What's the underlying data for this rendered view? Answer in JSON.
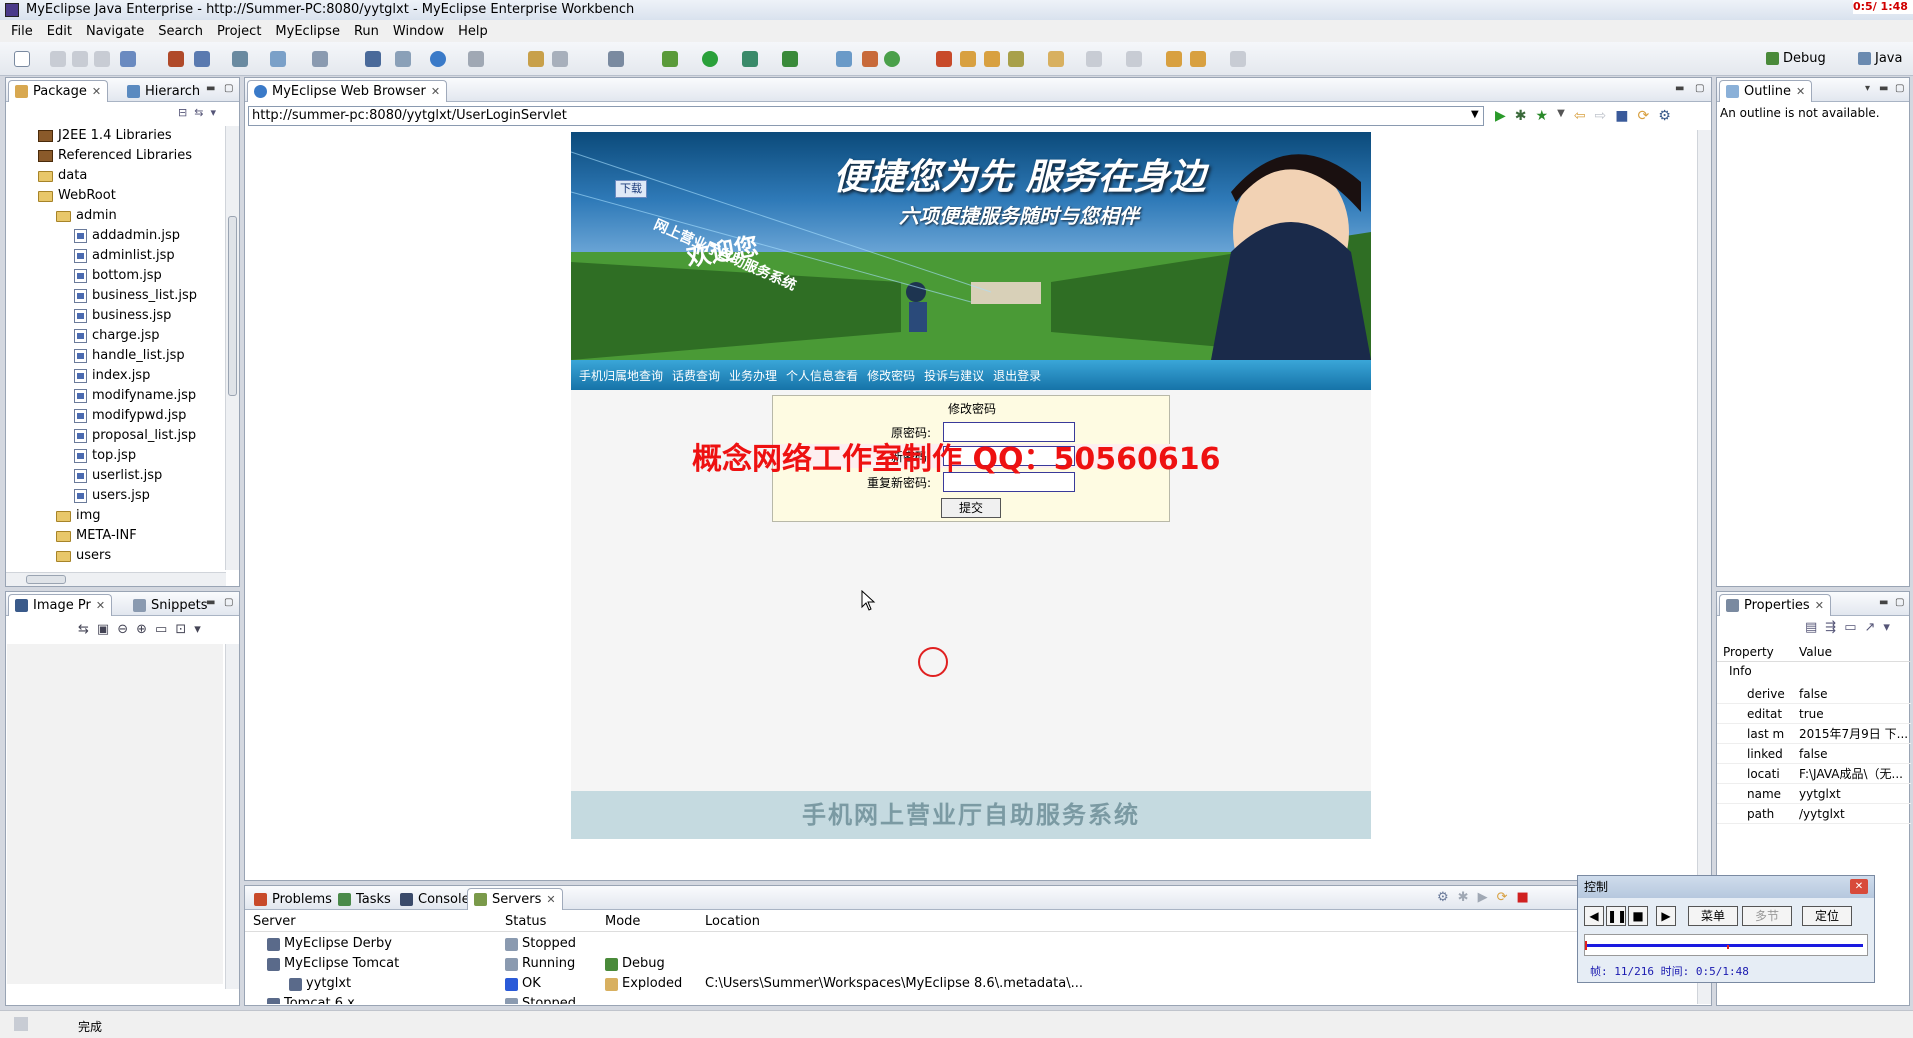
{
  "window": {
    "title": "MyEclipse Java Enterprise - http://Summer-PC:8080/yytglxt - MyEclipse Enterprise Workbench",
    "recorder_time": "0:5/ 1:48"
  },
  "menu": [
    "File",
    "Edit",
    "Navigate",
    "Search",
    "Project",
    "MyEclipse",
    "Run",
    "Window",
    "Help"
  ],
  "perspectives": {
    "debug": "Debug",
    "java": "Java"
  },
  "package_explorer": {
    "tabs": [
      "Package",
      "Hierarch"
    ],
    "items": [
      {
        "label": "J2EE 1.4 Libraries",
        "indent": 1,
        "kind": "lib"
      },
      {
        "label": "Referenced Libraries",
        "indent": 1,
        "kind": "lib"
      },
      {
        "label": "data",
        "indent": 1,
        "kind": "folder"
      },
      {
        "label": "WebRoot",
        "indent": 1,
        "kind": "folder"
      },
      {
        "label": "admin",
        "indent": 2,
        "kind": "folder"
      },
      {
        "label": "addadmin.jsp",
        "indent": 3,
        "kind": "jsp"
      },
      {
        "label": "adminlist.jsp",
        "indent": 3,
        "kind": "jsp"
      },
      {
        "label": "bottom.jsp",
        "indent": 3,
        "kind": "jsp"
      },
      {
        "label": "business_list.jsp",
        "indent": 3,
        "kind": "jsp"
      },
      {
        "label": "business.jsp",
        "indent": 3,
        "kind": "jsp"
      },
      {
        "label": "charge.jsp",
        "indent": 3,
        "kind": "jsp"
      },
      {
        "label": "handle_list.jsp",
        "indent": 3,
        "kind": "jsp"
      },
      {
        "label": "index.jsp",
        "indent": 3,
        "kind": "jsp"
      },
      {
        "label": "modifyname.jsp",
        "indent": 3,
        "kind": "jsp"
      },
      {
        "label": "modifypwd.jsp",
        "indent": 3,
        "kind": "jsp"
      },
      {
        "label": "proposal_list.jsp",
        "indent": 3,
        "kind": "jsp"
      },
      {
        "label": "top.jsp",
        "indent": 3,
        "kind": "jsp"
      },
      {
        "label": "userlist.jsp",
        "indent": 3,
        "kind": "jsp"
      },
      {
        "label": "users.jsp",
        "indent": 3,
        "kind": "jsp"
      },
      {
        "label": "img",
        "indent": 2,
        "kind": "folder"
      },
      {
        "label": "META-INF",
        "indent": 2,
        "kind": "folder"
      },
      {
        "label": "users",
        "indent": 2,
        "kind": "folder"
      }
    ]
  },
  "image_panel": {
    "tabs": [
      "Image Pr",
      "Snippets"
    ]
  },
  "browser": {
    "tab": "MyEclipse Web Browser",
    "url": "http://summer-pc:8080/yytglxt/UserLoginServlet",
    "site": {
      "download_button": "下载",
      "banner_title": "便捷您为先 服务在身边",
      "banner_subtitle": "六项便捷服务随时与您相伴",
      "banner_side": "网上营业厅自助服务系统",
      "banner_welcome": "欢迎您",
      "nav": [
        "手机归属地查询",
        "话费查询",
        "业务办理",
        "个人信息查看",
        "修改密码",
        "投诉与建议",
        "退出登录"
      ],
      "form": {
        "title": "修改密码",
        "old_label": "原密码:",
        "new_label": "新密码:",
        "confirm_label": "重复新密码:",
        "submit": "提交"
      },
      "footer": "手机网上营业厅自助服务系统"
    }
  },
  "watermark": "概念网络工作室制作 QQ：50560616",
  "outline": {
    "tab": "Outline",
    "message": "An outline is not available."
  },
  "properties": {
    "tab": "Properties",
    "headers": [
      "Property",
      "Value"
    ],
    "group": "Info",
    "rows": [
      {
        "key": "derive",
        "value": "false"
      },
      {
        "key": "editat",
        "value": "true"
      },
      {
        "key": "last m",
        "value": "2015年7月9日 下..."
      },
      {
        "key": "linked",
        "value": "false"
      },
      {
        "key": "locati",
        "value": "F:\\JAVA成品\\（无..."
      },
      {
        "key": "name",
        "value": "yytglxt"
      },
      {
        "key": "path",
        "value": "/yytglxt"
      }
    ]
  },
  "bottom_tabs": [
    "Problems",
    "Tasks",
    "Console",
    "Servers"
  ],
  "servers": {
    "headers": [
      "Server",
      "Status",
      "Mode",
      "Location"
    ],
    "rows": [
      {
        "server": "MyEclipse Derby",
        "status": "Stopped",
        "mode": "",
        "location": "",
        "indent": 1
      },
      {
        "server": "MyEclipse Tomcat",
        "status": "Running",
        "mode": "Debug",
        "location": "",
        "indent": 1
      },
      {
        "server": "yytglxt",
        "status": "OK",
        "mode": "Exploded",
        "location": "C:\\Users\\Summer\\Workspaces\\MyEclipse 8.6\\.metadata\\...",
        "indent": 2
      },
      {
        "server": "Tomcat 6.x",
        "status": "Stopped",
        "mode": "",
        "location": "",
        "indent": 1
      }
    ]
  },
  "status_bar": {
    "text": "完成"
  },
  "control_panel": {
    "title": "控制",
    "menu_button": "菜单",
    "chapter_button": "多节",
    "locate_button": "定位",
    "frame_text": "帧: 11/216 时间: 0:5/1:48"
  },
  "colors": {
    "accent": "#1673a8",
    "watermark": "#ee1111",
    "status_ok": "#0033cc"
  }
}
